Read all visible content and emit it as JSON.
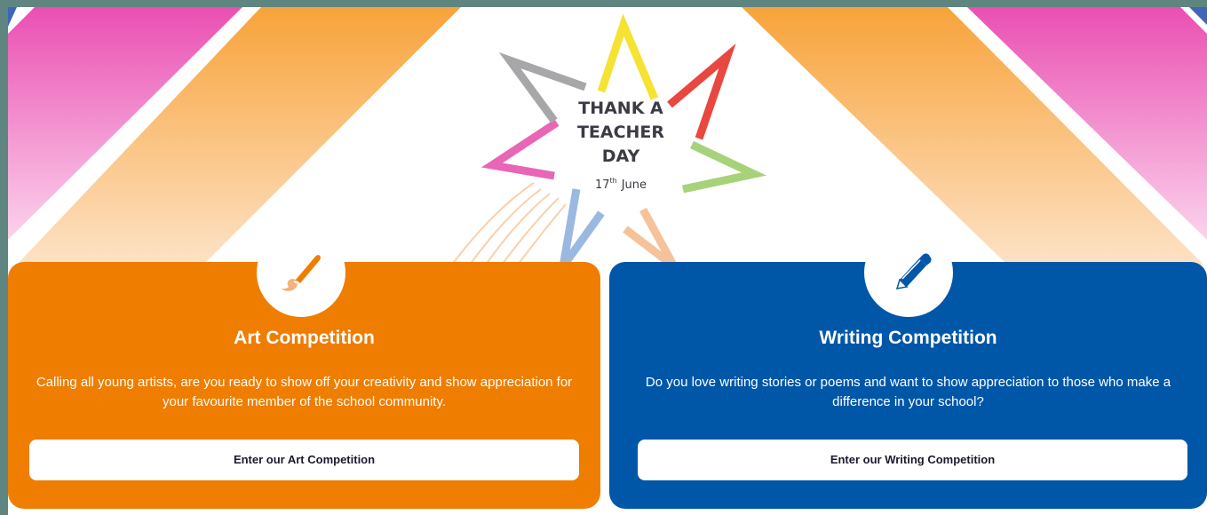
{
  "hero": {
    "logo_line1": "THANK A",
    "logo_line2": "TEACHER",
    "logo_line3": "DAY",
    "date_day": "17",
    "date_suffix": "th",
    "date_month": "June"
  },
  "cards": [
    {
      "id": "art",
      "title": "Art Competition",
      "description": "Calling all young artists, are you ready to show off your creativity and show appreciation for your favourite member of the school community.",
      "button_label": "Enter our Art Competition",
      "icon": "paintbrush-icon",
      "color": "#ef7d00"
    },
    {
      "id": "writing",
      "title": "Writing Competition",
      "description": "Do you love writing stories or poems and want to show appreciation to those who make a difference in your school?",
      "button_label": "Enter our Writing Competition",
      "icon": "pencil-icon",
      "color": "#0057a8"
    }
  ],
  "colors": {
    "frame": "#5f8581",
    "orange": "#ef7d00",
    "blue": "#0057a8",
    "pink": "#ea4fb2",
    "star_yellow": "#f6e233",
    "star_red": "#e8483f",
    "star_green": "#a7d27a",
    "star_grey": "#a7a7a9",
    "star_pink": "#e965b6",
    "star_light_blue": "#9bb8e0",
    "star_peach": "#f6c29a"
  }
}
